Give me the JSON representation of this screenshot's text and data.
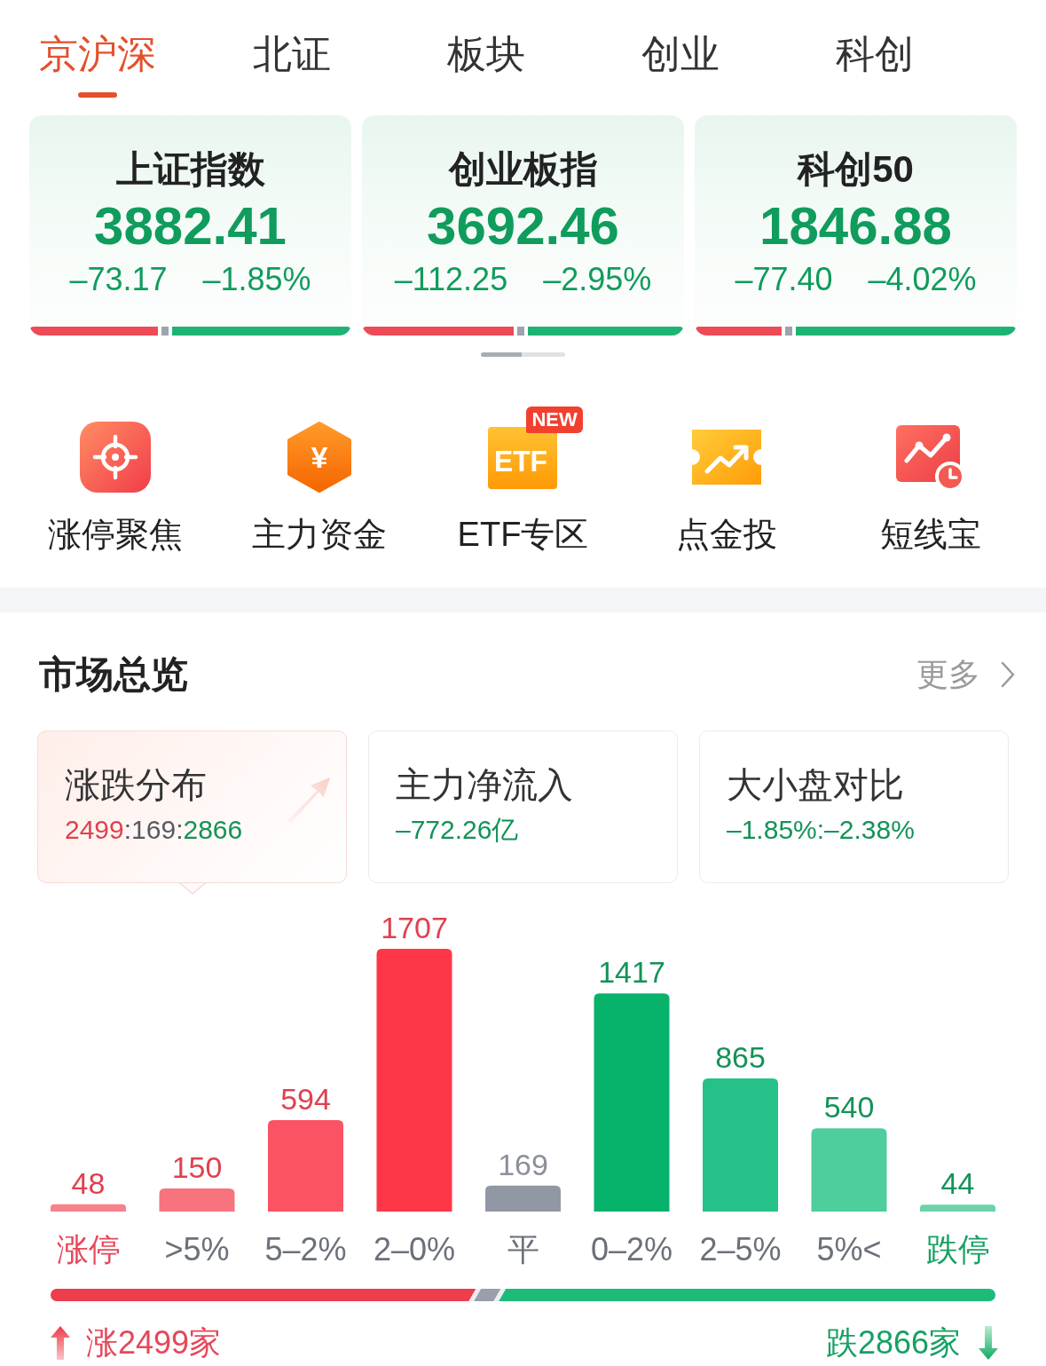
{
  "tabs": [
    {
      "label": "京沪深",
      "selected": true
    },
    {
      "label": "北证",
      "selected": false
    },
    {
      "label": "板块",
      "selected": false
    },
    {
      "label": "创业",
      "selected": false
    },
    {
      "label": "科创",
      "selected": false
    }
  ],
  "indices": [
    {
      "name": "上证指数",
      "value": "3882.41",
      "change": "–73.17",
      "change_pct": "–1.85%",
      "kind": "fall",
      "breadth": {
        "level": 0.4
      }
    },
    {
      "name": "创业板指",
      "value": "3692.46",
      "change": "–112.25",
      "change_pct": "–2.95%",
      "kind": "fall",
      "breadth": {
        "level": 0.47
      }
    },
    {
      "name": "科创50",
      "value": "1846.88",
      "change": "–77.40",
      "change_pct": "–4.02%",
      "kind": "fall",
      "breadth": {
        "level": 0.27
      }
    }
  ],
  "shortcuts": [
    {
      "label": "涨停聚焦"
    },
    {
      "label": "主力资金",
      "icon_text": "¥"
    },
    {
      "label": "ETF专区",
      "icon_text": "ETF",
      "badge": "NEW"
    },
    {
      "label": "点金投"
    },
    {
      "label": "短线宝"
    }
  ],
  "market_overview": {
    "title": "市场总览",
    "more": "更多",
    "cards": [
      {
        "title": "涨跌分布",
        "selected": true,
        "value": [
          {
            "text": "2499",
            "kind": "up"
          },
          {
            "text": ":169:",
            "kind": "flat"
          },
          {
            "text": "2866",
            "kind": "down"
          }
        ]
      },
      {
        "title": "主力净流入",
        "selected": false,
        "value": [
          {
            "text": "–772.26亿",
            "kind": "down"
          }
        ]
      },
      {
        "title": "大小盘对比",
        "selected": false,
        "value": [
          {
            "text": "–1.85%:–2.38%",
            "kind": "down"
          }
        ]
      }
    ]
  },
  "distribution": {
    "chart_data": {
      "type": "bar",
      "categories": [
        "涨停",
        ">5%",
        "5–2%",
        "2–0%",
        "平",
        "0–2%",
        "2–5%",
        "5%<",
        "跌停"
      ],
      "values": [
        48,
        150,
        594,
        1707,
        169,
        1417,
        865,
        540,
        44
      ],
      "data_labels": true
    },
    "bars": [
      {
        "kind": "limit_up",
        "color": "#f6838c"
      },
      {
        "kind": "up",
        "color": "#f7737e"
      },
      {
        "kind": "up",
        "color": "#fb5264"
      },
      {
        "kind": "up",
        "color": "#fd3747"
      },
      {
        "kind": "flat",
        "color": "#9297a4"
      },
      {
        "kind": "down",
        "color": "#07b26b"
      },
      {
        "kind": "down",
        "color": "#26c188"
      },
      {
        "kind": "down",
        "color": "#4ecd9d"
      },
      {
        "kind": "limit_down",
        "color": "#6dd3a8"
      }
    ],
    "breadth": {
      "level": 0.45
    },
    "rise_total": "涨2499家",
    "fall_total": "跌2866家"
  }
}
